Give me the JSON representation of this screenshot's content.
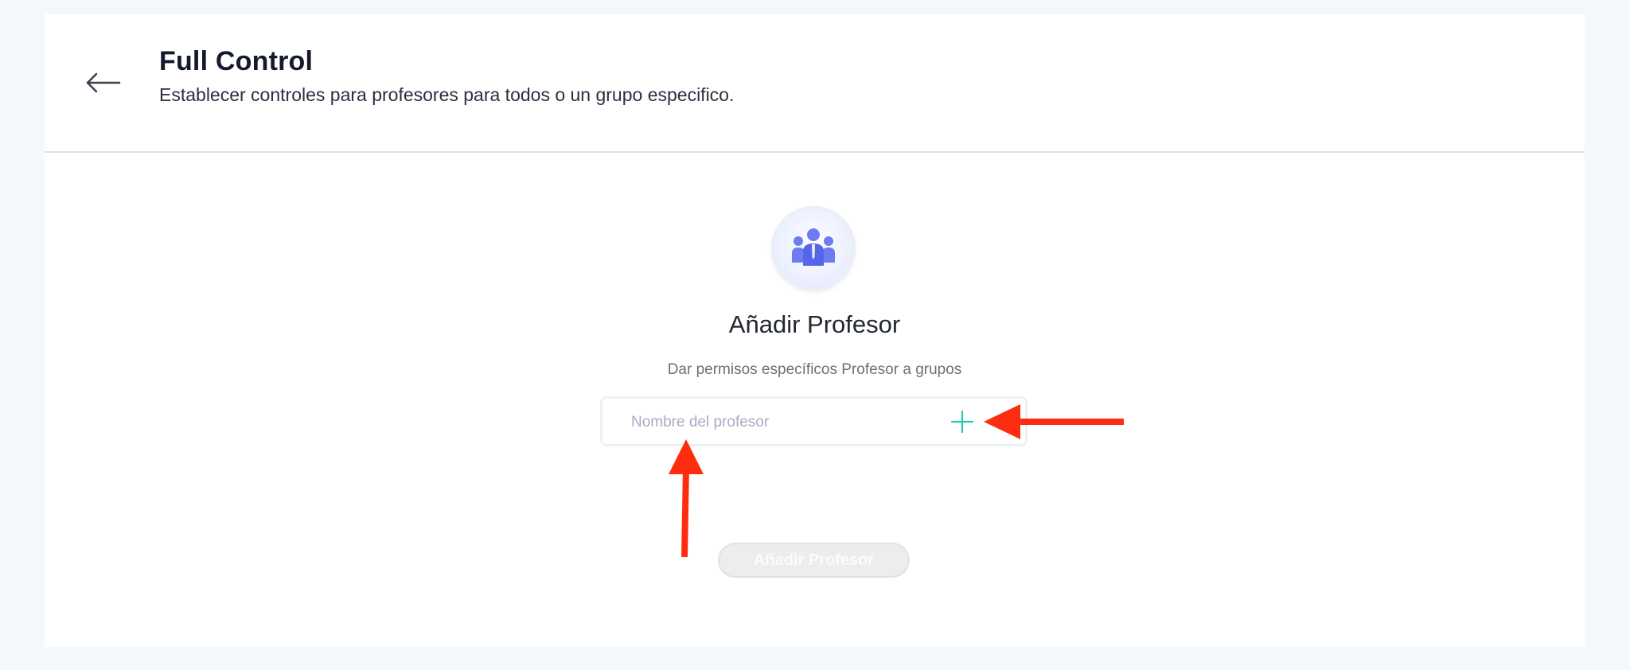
{
  "header": {
    "back_icon": "arrow-left-icon",
    "title": "Full Control",
    "subtitle": "Establecer controles para profesores para todos o un grupo especifico."
  },
  "main": {
    "avatar_icon": "people-group-icon",
    "title": "Añadir Profesor",
    "description": "Dar permisos específicos Profesor a grupos",
    "teacher_input": {
      "placeholder": "Nombre del profesor",
      "value": ""
    },
    "add_icon": "plus-icon",
    "submit_label": "Añadir Profesor",
    "submit_enabled": false
  },
  "annotations": {
    "arrow_color": "#ff2d0f",
    "arrows": [
      "pointing-to-add-icon",
      "pointing-to-teacher-input"
    ]
  },
  "colors": {
    "page_background": "#f5f8fa",
    "card_background": "#ffffff",
    "accent_teal": "#2ec4b6",
    "avatar_blue": "#6f7ff0",
    "disabled_button": "#ededed"
  }
}
